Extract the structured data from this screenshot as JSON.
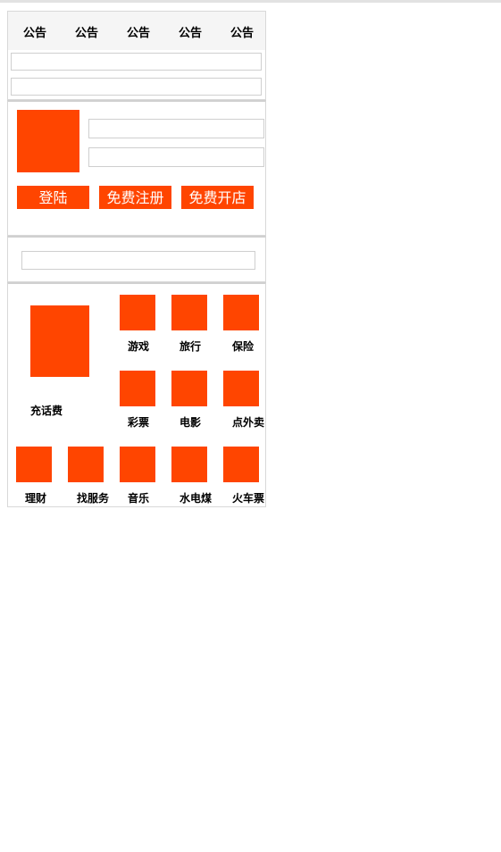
{
  "colors": {
    "accent": "#ff4500"
  },
  "notice": {
    "tabs": [
      "公告",
      "公告",
      "公告",
      "公告",
      "公告"
    ]
  },
  "login": {
    "login_label": "登陆",
    "register_label": "免费注册",
    "open_shop_label": "免费开店"
  },
  "services": {
    "featured_label": "充话费",
    "grid": [
      "游戏",
      "旅行",
      "保险",
      "彩票",
      "电影",
      "点外卖"
    ],
    "row": [
      "理财",
      "找服务",
      "音乐",
      "水电煤",
      "火车票"
    ]
  }
}
